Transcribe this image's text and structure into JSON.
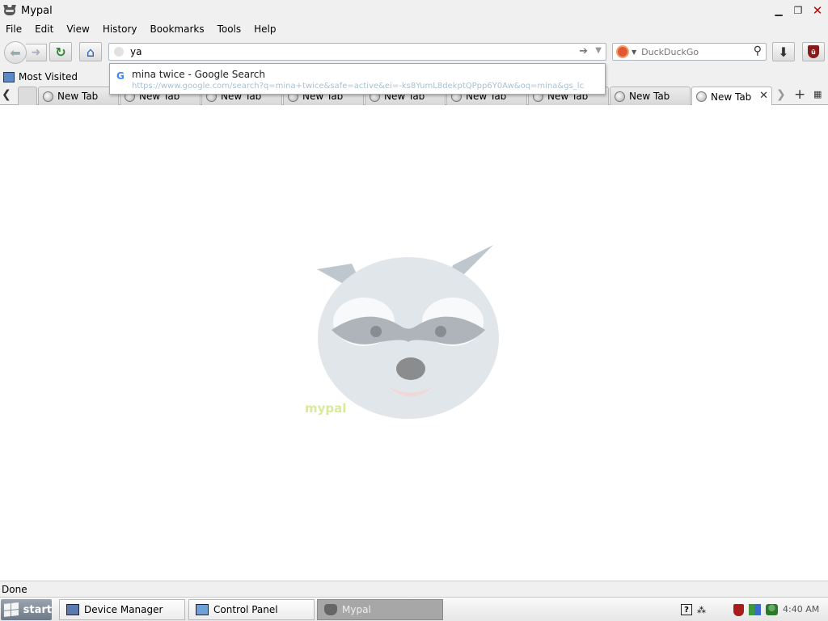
{
  "window": {
    "title": "Mypal"
  },
  "menu": [
    "File",
    "Edit",
    "View",
    "History",
    "Bookmarks",
    "Tools",
    "Help"
  ],
  "urlbar": {
    "value": "ya"
  },
  "search": {
    "engine": "DuckDuckGo",
    "placeholder": "DuckDuckGo"
  },
  "autocomplete": {
    "title": "mina twice - Google Search",
    "url": "https://www.google.com/search?q=mina+twice&safe=active&ei=-ks8YumL8dekptQPpp6Y0Aw&oq=mina&gs_lcp=..."
  },
  "bookmarks": {
    "most_visited": "Most Visited"
  },
  "tabs": [
    {
      "label": "New Tab"
    },
    {
      "label": "New Tab"
    },
    {
      "label": "New Tab"
    },
    {
      "label": "New Tab"
    },
    {
      "label": "New Tab"
    },
    {
      "label": "New Tab"
    },
    {
      "label": "New Tab"
    },
    {
      "label": "New Tab"
    },
    {
      "label": "New Tab"
    }
  ],
  "content": {
    "watermark_text": "mypal"
  },
  "status": {
    "text": "Done"
  },
  "taskbar": {
    "start": "start",
    "tasks": [
      {
        "label": "Device Manager"
      },
      {
        "label": "Control Panel"
      },
      {
        "label": "Mypal"
      }
    ],
    "clock": "4:40 AM"
  },
  "colors": {
    "active_task_bg": "#a7a7a7",
    "content_bg": "#ffffff"
  }
}
